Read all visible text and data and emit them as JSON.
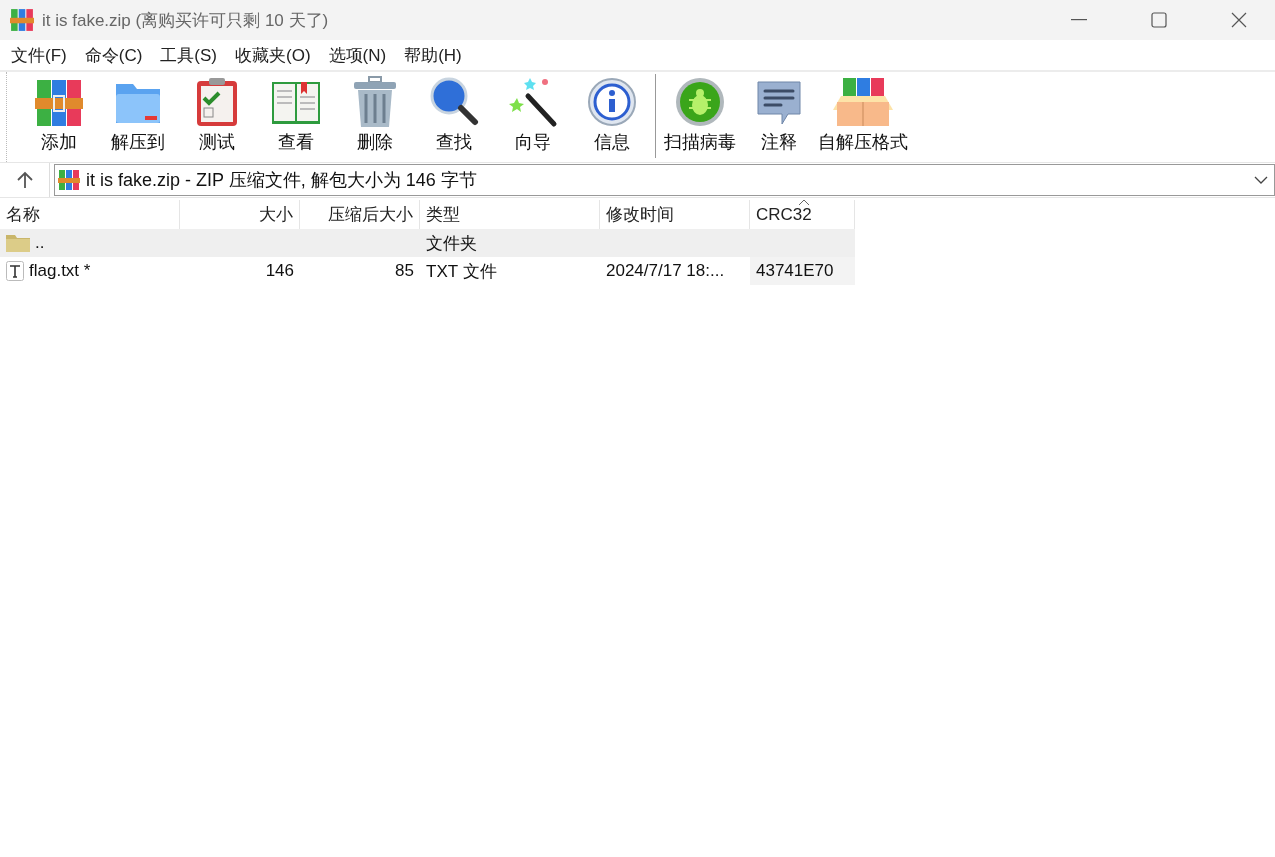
{
  "window": {
    "title": "it is fake.zip (离购买许可只剩 10 天了)"
  },
  "menu": [
    "文件(F)",
    "命令(C)",
    "工具(S)",
    "收藏夹(O)",
    "选项(N)",
    "帮助(H)"
  ],
  "toolbar": [
    {
      "label": "添加",
      "separator_before": false
    },
    {
      "label": "解压到",
      "separator_before": false
    },
    {
      "label": "测试",
      "separator_before": false
    },
    {
      "label": "查看",
      "separator_before": false
    },
    {
      "label": "删除",
      "separator_before": false
    },
    {
      "label": "查找",
      "separator_before": false
    },
    {
      "label": "向导",
      "separator_before": false
    },
    {
      "label": "信息",
      "separator_before": false
    },
    {
      "label": "扫描病毒",
      "separator_before": true
    },
    {
      "label": "注释",
      "separator_before": false
    },
    {
      "label": "自解压格式",
      "separator_before": false
    }
  ],
  "address": {
    "value": "it is fake.zip - ZIP 压缩文件, 解包大小为 146 字节"
  },
  "table": {
    "columns": [
      {
        "label": "名称",
        "sorted": false
      },
      {
        "label": "大小",
        "sorted": false
      },
      {
        "label": "压缩后大小",
        "sorted": false
      },
      {
        "label": "类型",
        "sorted": false
      },
      {
        "label": "修改时间",
        "sorted": false
      },
      {
        "label": "CRC32",
        "sorted": true
      }
    ],
    "rows": [
      {
        "kind": "folder",
        "selected": true,
        "cells": [
          "..",
          "",
          "",
          "文件夹",
          "",
          ""
        ]
      },
      {
        "kind": "text-file",
        "selected": false,
        "cells": [
          "flag.txt *",
          "146",
          "85",
          "TXT 文件",
          "2024/7/17 18:...",
          "43741E70"
        ]
      }
    ]
  }
}
